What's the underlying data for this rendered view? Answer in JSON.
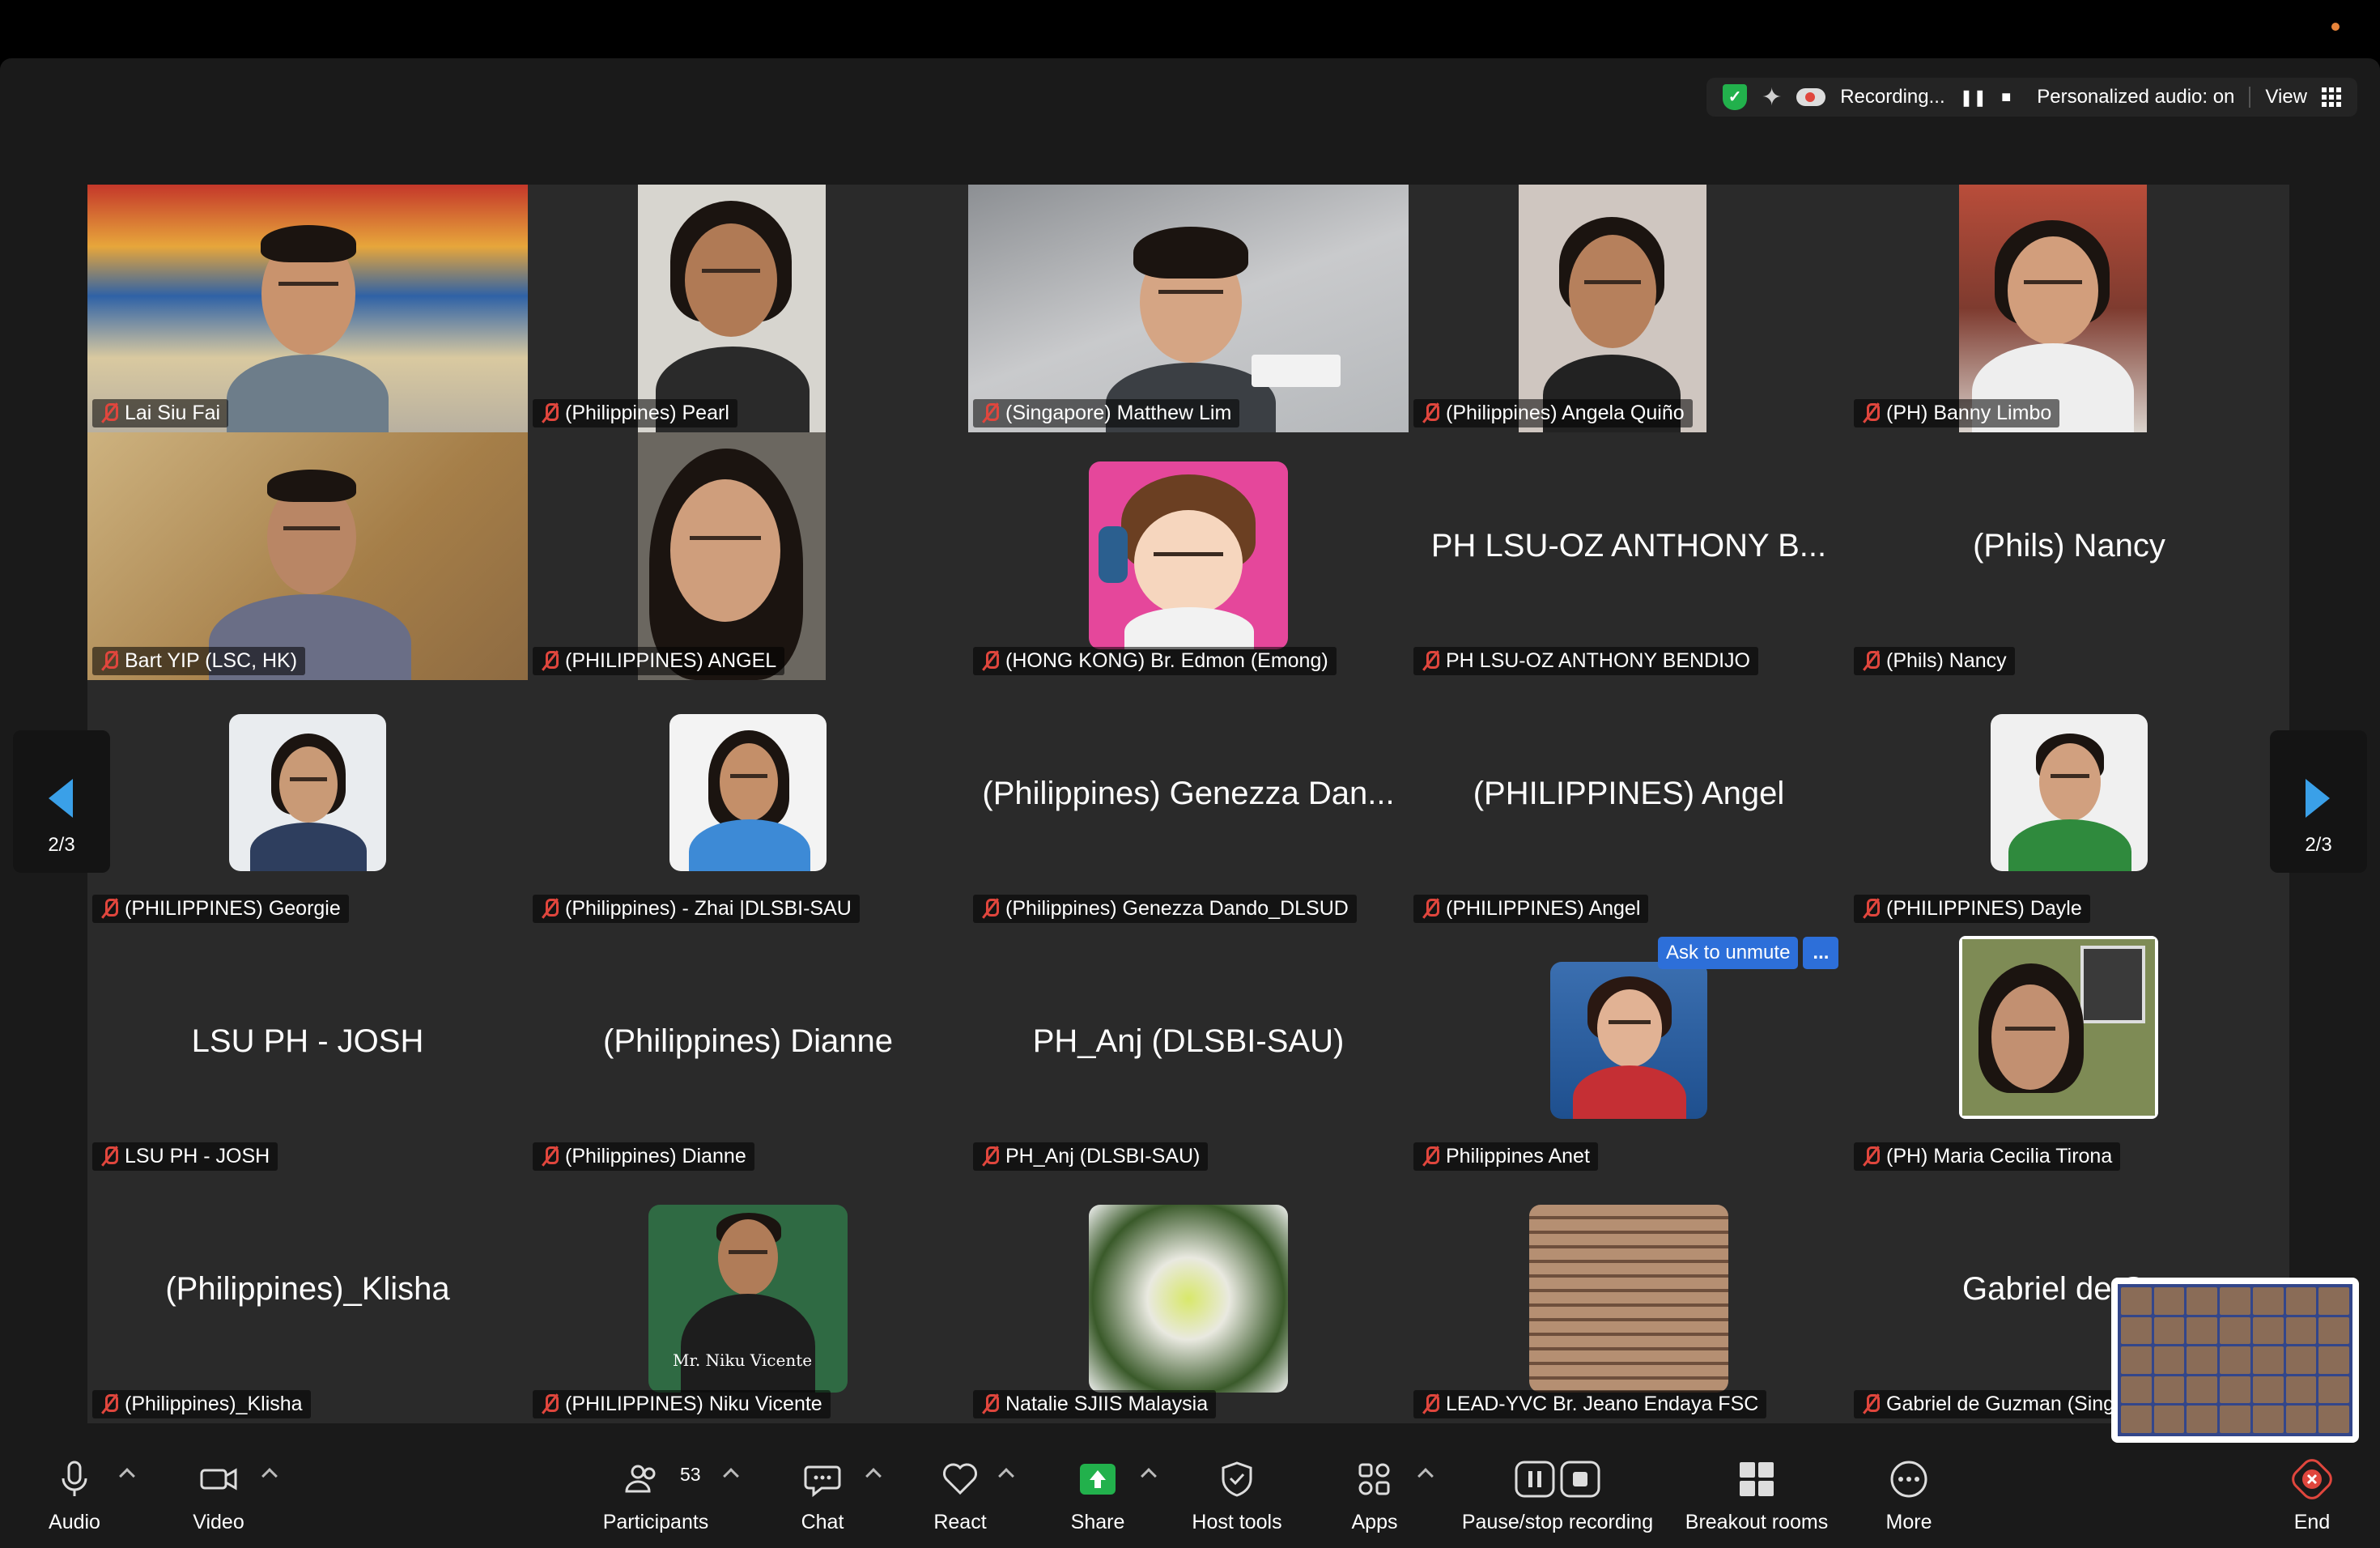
{
  "status": {
    "recording": "Recording...",
    "audio": "Personalized audio: on",
    "view": "View"
  },
  "colors": {
    "accent": "#2d6fd9",
    "arrow": "#3aa0e8",
    "share": "#22b14c",
    "end": "#e0463d"
  },
  "tiles": [
    {
      "label": "Lai Siu Fai"
    },
    {
      "label": "(Philippines) Pearl"
    },
    {
      "label": "(Singapore) Matthew Lim"
    },
    {
      "label": "(Philippines) Angela Quiño"
    },
    {
      "label": "(PH) Banny Limbo"
    },
    {
      "label": "Bart YIP (LSC, HK)"
    },
    {
      "label": "(PHILIPPINES) ANGEL"
    },
    {
      "label": "(HONG KONG) Br. Edmon (Emong)"
    },
    {
      "label": "PH LSU-OZ ANTHONY BENDIJO",
      "big": "PH LSU-OZ ANTHONY B..."
    },
    {
      "label": "(Phils) Nancy",
      "big": "(Phils) Nancy"
    },
    {
      "label": "(PHILIPPINES) Georgie"
    },
    {
      "label": "(Philippines) - Zhai |DLSBI-SAU"
    },
    {
      "label": "(Philippines) Genezza Dando_DLSUD",
      "big": "(Philippines) Genezza Dan..."
    },
    {
      "label": "(PHILIPPINES) Angel",
      "big": "(PHILIPPINES) Angel"
    },
    {
      "label": "(PHILIPPINES) Dayle"
    },
    {
      "label": "LSU PH - JOSH",
      "big": "LSU PH - JOSH"
    },
    {
      "label": "(Philippines) Dianne",
      "big": "(Philippines) Dianne"
    },
    {
      "label": "PH_Anj (DLSBI-SAU)",
      "big": "PH_Anj (DLSBI-SAU)"
    },
    {
      "label": "Philippines Anet"
    },
    {
      "label": "(PH) Maria Cecilia Tirona"
    },
    {
      "label": "(Philippines)_Klisha",
      "big": "(Philippines)_Klisha"
    },
    {
      "label": "(PHILIPPINES) Niku Vicente",
      "caption": "Mr. Niku Vicente"
    },
    {
      "label": "Natalie SJIIS Malaysia"
    },
    {
      "label": "LEAD-YVC Br. Jeano Endaya FSC"
    },
    {
      "label": "Gabriel de Guzman (Sing",
      "big": "Gabriel de Guzm"
    }
  ],
  "pager": {
    "left": "2/3",
    "right": "2/3"
  },
  "popup": {
    "unmute": "Ask to unmute",
    "more": "..."
  },
  "toolbar": {
    "audio": "Audio",
    "video": "Video",
    "participants": "Participants",
    "participants_count": "53",
    "chat": "Chat",
    "react": "React",
    "share": "Share",
    "host_tools": "Host tools",
    "apps": "Apps",
    "pause_stop": "Pause/stop recording",
    "breakout": "Breakout rooms",
    "more": "More",
    "end": "End"
  }
}
